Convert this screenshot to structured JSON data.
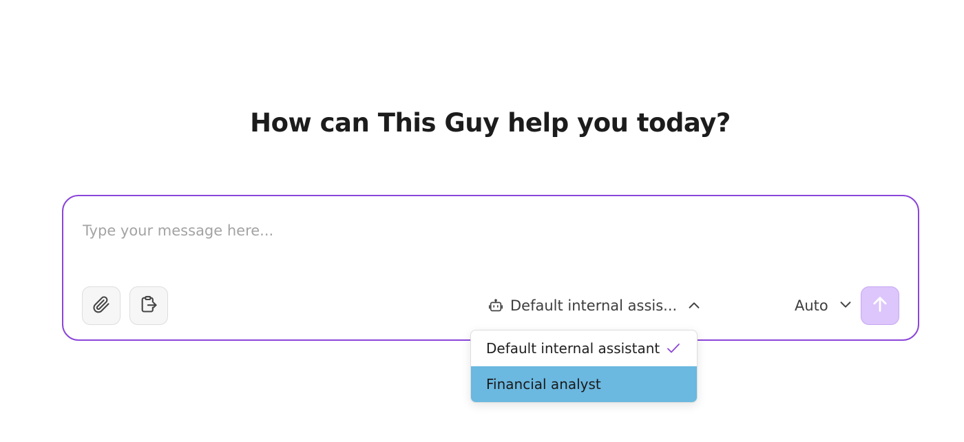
{
  "heading": "How can This Guy help you today?",
  "composer": {
    "placeholder": "Type your message here...",
    "value": ""
  },
  "toolbar": {
    "attach_icon": "paperclip-icon",
    "clipboard_icon": "clipboard-export-icon",
    "assistant_label": "Default internal assis...",
    "assistant_icon": "robot-icon",
    "model_label": "Auto",
    "send_icon": "arrow-up-icon"
  },
  "assistant_menu": {
    "items": [
      {
        "label": "Default internal assistant",
        "selected": true
      },
      {
        "label": "Financial analyst",
        "selected": false
      }
    ]
  },
  "colors": {
    "accent": "#8b45d9",
    "send_bg": "#dcc6fb",
    "menu_highlight": "#6bb8e0"
  }
}
